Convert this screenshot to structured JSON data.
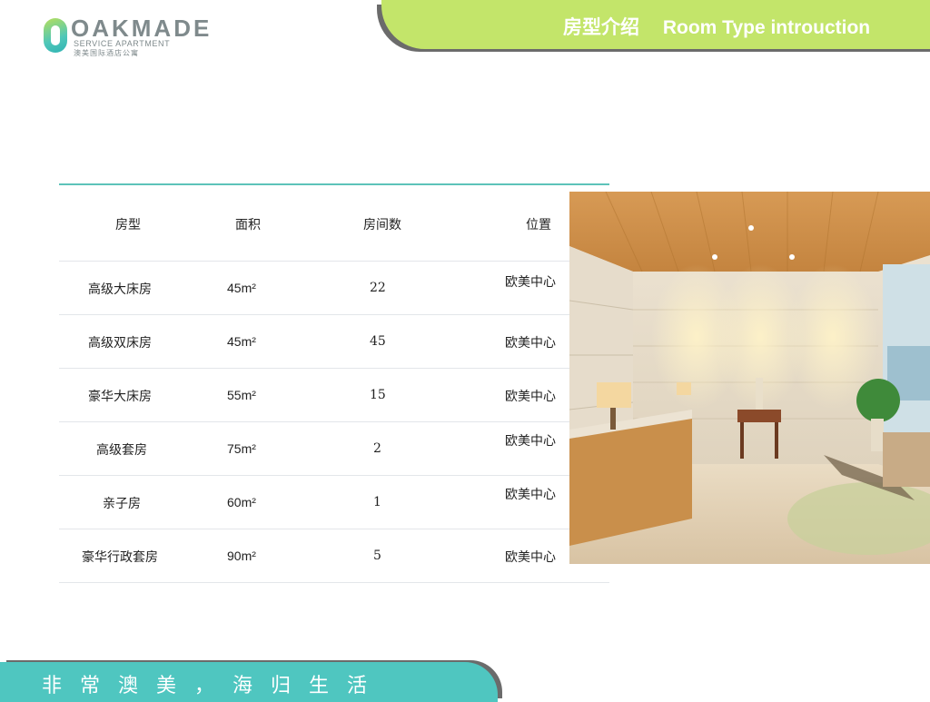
{
  "logo": {
    "word": "OAKMADE",
    "sub": "SERVICE APARTMENT",
    "cn": "澳美国际酒店公寓"
  },
  "header": {
    "title_cn": "房型介绍",
    "title_en": "Room Type introuction"
  },
  "table": {
    "headers": [
      "房型",
      "面积",
      "房间数",
      "位置"
    ],
    "rows": [
      {
        "type": "高级大床房",
        "area": "45m²",
        "count": "22",
        "location": "欧美中心"
      },
      {
        "type": "高级双床房",
        "area": "45m²",
        "count": "45",
        "location": "欧美中心"
      },
      {
        "type": "豪华大床房",
        "area": "55m²",
        "count": "15",
        "location": "欧美中心"
      },
      {
        "type": "高级套房",
        "area": "75m²",
        "count": "2",
        "location": "欧美中心"
      },
      {
        "type": "亲子房",
        "area": "60m²",
        "count": "1",
        "location": "欧美中心"
      },
      {
        "type": "豪华行政套房",
        "area": "90m²",
        "count": "5",
        "location": "欧美中心"
      }
    ]
  },
  "footer": {
    "slogan": "非常澳美，海归生活"
  },
  "colors": {
    "header_green": "#c3e56a",
    "footer_teal": "#4fc6c0",
    "table_rule": "#5dc3b9"
  }
}
